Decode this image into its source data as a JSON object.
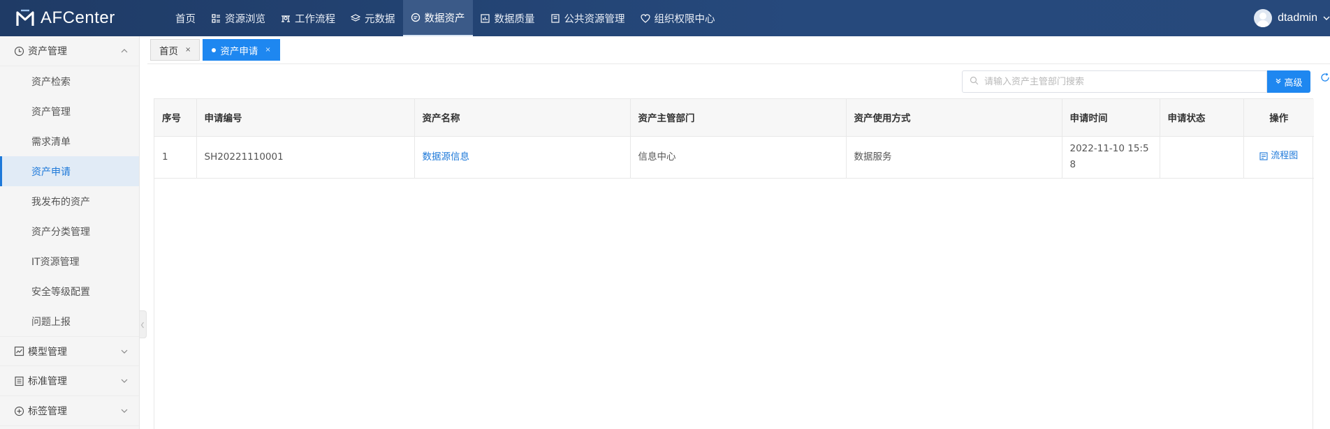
{
  "brand": {
    "name": "AFCenter"
  },
  "nav": [
    {
      "label": "首页",
      "icon": "none"
    },
    {
      "label": "资源浏览",
      "icon": "grid-list-icon"
    },
    {
      "label": "工作流程",
      "icon": "workflow-icon"
    },
    {
      "label": "元数据",
      "icon": "layers-icon"
    },
    {
      "label": "数据资产",
      "icon": "data-asset-icon",
      "active": true
    },
    {
      "label": "数据质量",
      "icon": "bar-chart-icon"
    },
    {
      "label": "公共资源管理",
      "icon": "document-icon"
    },
    {
      "label": "组织权限中心",
      "icon": "heart-shield-icon"
    }
  ],
  "user": {
    "name": "dtadmin"
  },
  "sidebar": {
    "group_asset": "资产管理",
    "items": [
      "资产检索",
      "资产管理",
      "需求清单",
      "资产申请",
      "我发布的资产",
      "资产分类管理",
      "IT资源管理",
      "安全等级配置",
      "问题上报"
    ],
    "active_index": 3,
    "group_model": "模型管理",
    "group_standard": "标准管理",
    "group_tag": "标签管理"
  },
  "tabs": [
    {
      "label": "首页",
      "close": "×"
    },
    {
      "label": "资产申请",
      "close": "×",
      "active": true
    }
  ],
  "search": {
    "placeholder": "请输入资产主管部门搜索",
    "advanced_label": "高级"
  },
  "table": {
    "columns": [
      "序号",
      "申请编号",
      "资产名称",
      "资产主管部门",
      "资产使用方式",
      "申请时间",
      "申请状态",
      "操作"
    ],
    "rows": [
      {
        "index": "1",
        "code": "SH20221110001",
        "asset_name": "数据源信息",
        "department": "信息中心",
        "usage": "数据服务",
        "time": "2022-11-10 15:58",
        "status": "",
        "action": "流程图"
      }
    ]
  },
  "colors": {
    "primary": "#1e87f0",
    "topbar": "#1f3b66",
    "link": "#1e79d9"
  }
}
